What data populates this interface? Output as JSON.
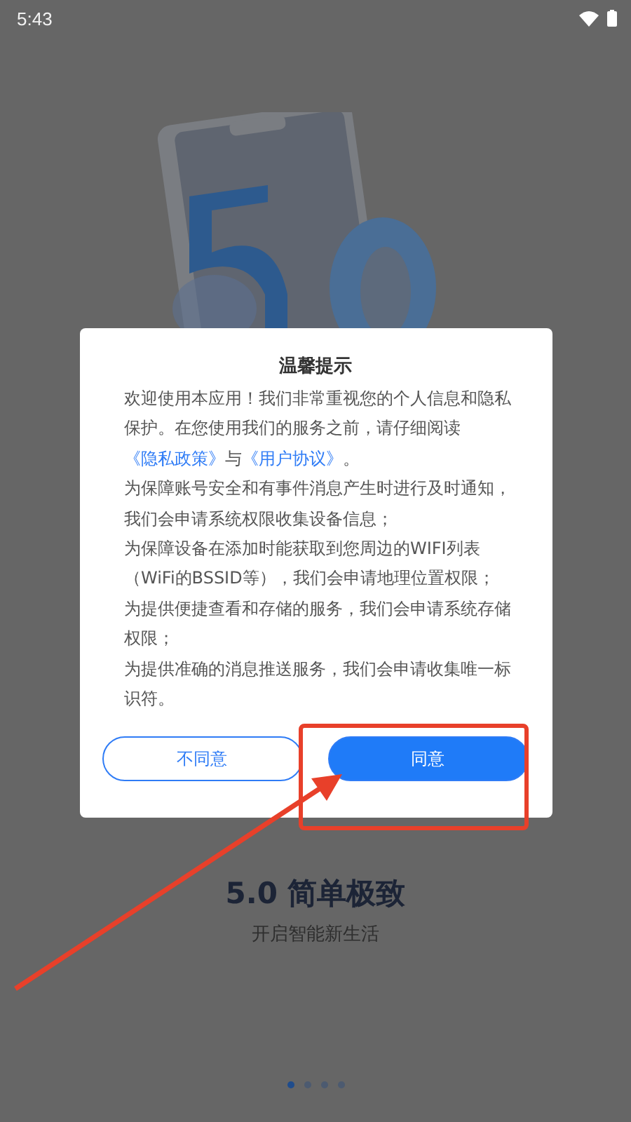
{
  "status_bar": {
    "time": "5:43"
  },
  "dialog": {
    "title": "温馨提示",
    "paragraphs": [
      {
        "segments": [
          {
            "kind": "text",
            "text": "欢迎使用本应用！我们非常重视您的个人信息和隐私保护。在您使用我们的服务之前，请仔细阅读"
          },
          {
            "kind": "link",
            "text": "《隐私政策》"
          },
          {
            "kind": "text",
            "text": "与"
          },
          {
            "kind": "link",
            "text": "《用户协议》"
          },
          {
            "kind": "text",
            "text": "。"
          }
        ]
      },
      {
        "segments": [
          {
            "kind": "text",
            "text": "为保障账号安全和有事件消息产生时进行及时通知，我们会申请系统权限收集设备信息；"
          }
        ]
      },
      {
        "segments": [
          {
            "kind": "text",
            "text": "为保障设备在添加时能获取到您周边的WIFI列表（WiFi的BSSID等），我们会申请地理位置权限；"
          }
        ]
      },
      {
        "segments": [
          {
            "kind": "text",
            "text": "为提供便捷查看和存储的服务，我们会申请系统存储权限；"
          }
        ]
      },
      {
        "segments": [
          {
            "kind": "text",
            "text": "为提供准确的消息推送服务，我们会申请收集唯一标识符。"
          }
        ]
      }
    ],
    "buttons": [
      {
        "label": "不同意",
        "kind": "outline"
      },
      {
        "label": "同意",
        "kind": "primary"
      }
    ]
  },
  "headline": "5.0 简单极致",
  "subtitle": "开启智能新生活",
  "pager": [
    {
      "selected": true
    },
    {
      "selected": false
    },
    {
      "selected": false
    },
    {
      "selected": false
    }
  ]
}
